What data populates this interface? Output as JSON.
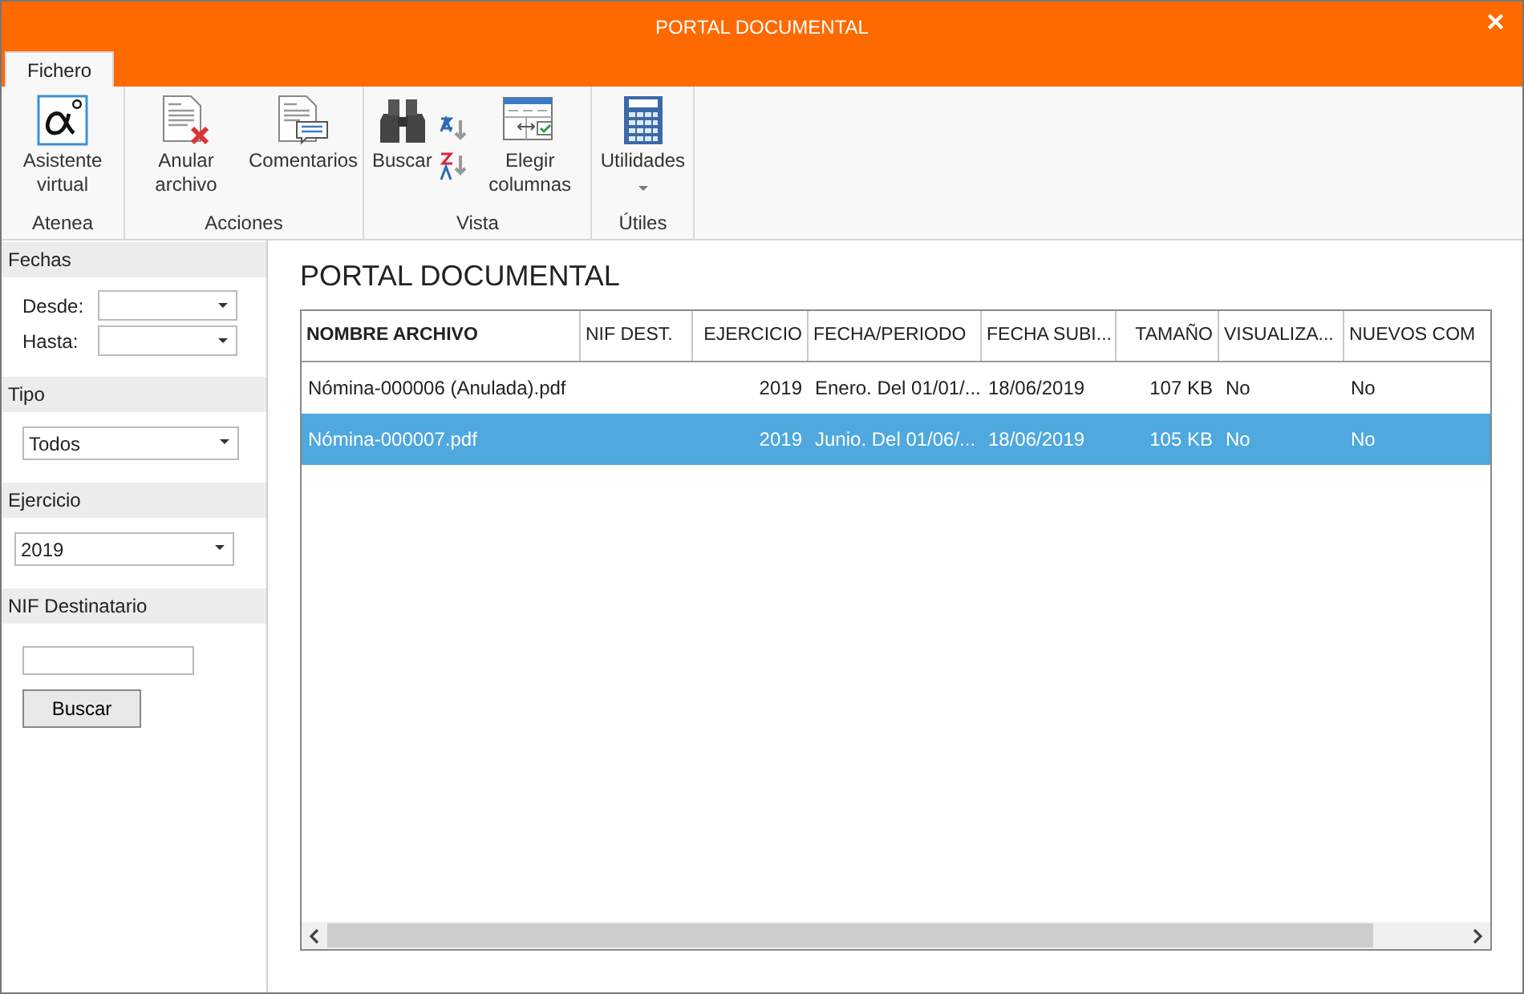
{
  "window": {
    "title": "PORTAL DOCUMENTAL",
    "close": "✕"
  },
  "ribbon_tabs": [
    {
      "label": "Fichero",
      "selected": true
    }
  ],
  "ribbon_groups": [
    {
      "label": "Atenea",
      "buttons": [
        {
          "kind": "alpha",
          "label": "Asistente virtual"
        }
      ]
    },
    {
      "label": "Acciones",
      "buttons": [
        {
          "kind": "cancel-doc",
          "label": "Anular archivo"
        },
        {
          "kind": "comment-doc",
          "label": "Comentarios"
        }
      ]
    },
    {
      "label": "Vista",
      "buttons": [
        {
          "kind": "binoculars",
          "label": "Buscar"
        },
        {
          "kind": "sort-pair"
        },
        {
          "kind": "columns",
          "label": "Elegir columnas"
        }
      ]
    },
    {
      "label": "Útiles",
      "buttons": [
        {
          "kind": "calculator",
          "label": "Utilidades",
          "dropdown": true
        }
      ]
    }
  ],
  "sidebar": [
    {
      "kind": "dates",
      "header": "Fechas",
      "fields": [
        {
          "label": "Desde:"
        },
        {
          "label": "Hasta:"
        }
      ]
    },
    {
      "kind": "select",
      "header": "Tipo",
      "value": "Todos"
    },
    {
      "kind": "select-wide",
      "header": "Ejercicio",
      "value": "2019"
    },
    {
      "kind": "text-search",
      "header": "NIF Destinatario",
      "button": "Buscar"
    }
  ],
  "main": {
    "title": "PORTAL DOCUMENTAL",
    "table": {
      "columns": [
        {
          "label": "NOMBRE ARCHIVO",
          "kind": "text"
        },
        {
          "label": "NIF DEST.",
          "kind": "text"
        },
        {
          "label": "EJERCICIO",
          "kind": "number"
        },
        {
          "label": "FECHA/PERIODO",
          "kind": "text"
        },
        {
          "label": "FECHA SUBI...",
          "kind": "text"
        },
        {
          "label": "TAMAÑO",
          "kind": "number"
        },
        {
          "label": "VISUALIZA...",
          "kind": "text"
        },
        {
          "label": "NUEVOS COM",
          "kind": "text"
        }
      ],
      "rows": [
        {
          "selected": false,
          "cells": [
            "Nómina-000006 (Anulada).pdf",
            "",
            "2019",
            "Enero. Del 01/01/...",
            "18/06/2019",
            "107 KB",
            "No",
            "No"
          ]
        },
        {
          "selected": true,
          "cells": [
            "Nómina-000007.pdf",
            "",
            "2019",
            "Junio. Del 01/06/...",
            "18/06/2019",
            "105 KB",
            "No",
            "No"
          ]
        }
      ]
    }
  }
}
